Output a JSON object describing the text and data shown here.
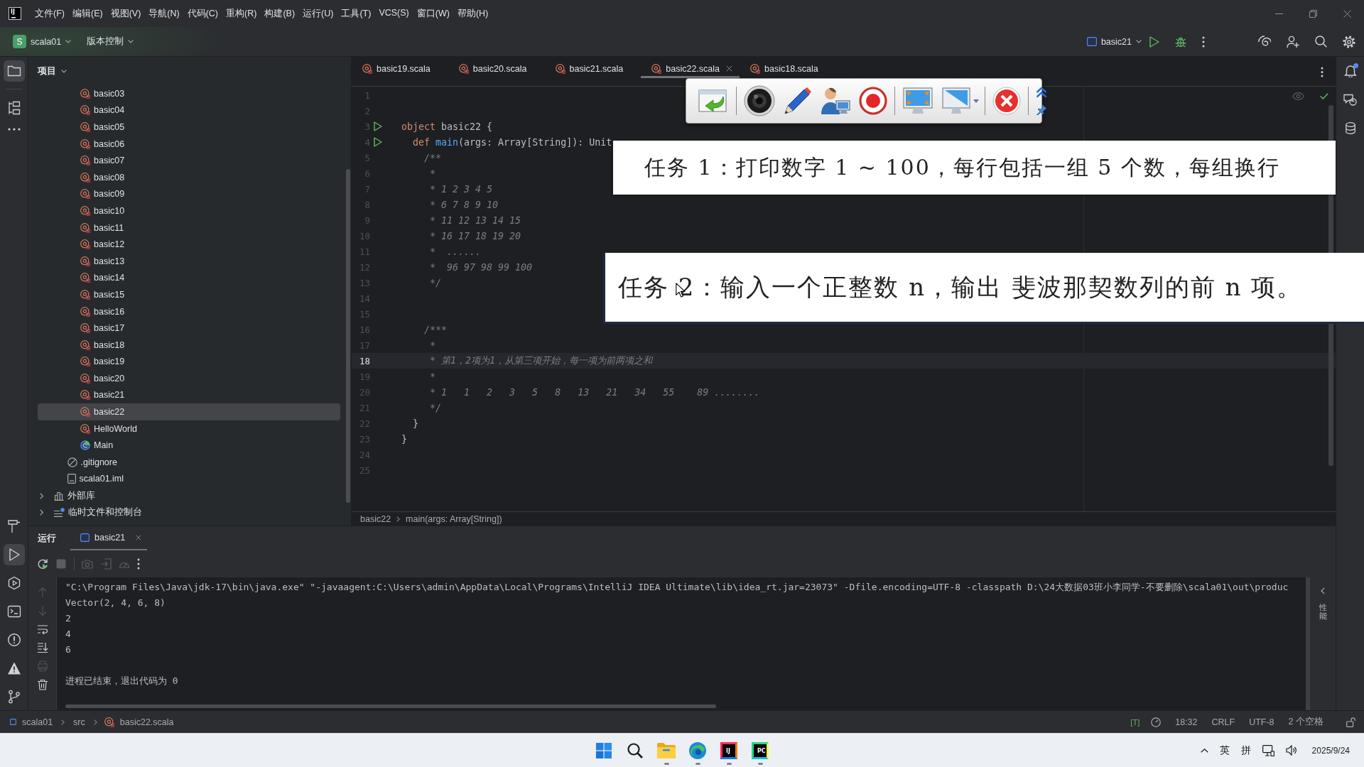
{
  "title_bar": {
    "logo": "IJ",
    "menu": [
      "文件(F)",
      "编辑(E)",
      "视图(V)",
      "导航(N)",
      "代码(C)",
      "重构(R)",
      "构建(B)",
      "运行(U)",
      "工具(T)",
      "VCS(S)",
      "窗口(W)",
      "帮助(H)"
    ]
  },
  "toolbar": {
    "project_badge": "S",
    "project": "scala01",
    "vcs": "版本控制",
    "run_config": "basic21"
  },
  "tool_strip": {
    "top": [
      {
        "selected": true
      },
      {
        "selected": false
      },
      {
        "selected": false
      }
    ],
    "bottom": [
      {
        "selected": false
      },
      {
        "selected": true
      },
      {
        "selected": false
      },
      {
        "selected": false
      },
      {
        "selected": false
      },
      {
        "selected": false
      },
      {
        "selected": false
      }
    ]
  },
  "right_strip": {
    "notifications_unread": true
  },
  "project_panel": {
    "title": "项目",
    "tree": [
      {
        "children": [
          {
            "children": [
              {
                "label": "basic03",
                "kind": "object",
                "selected": false
              },
              {
                "label": "basic04",
                "kind": "object",
                "selected": false
              },
              {
                "label": "basic05",
                "kind": "object",
                "selected": false
              },
              {
                "label": "basic06",
                "kind": "object",
                "selected": false
              },
              {
                "label": "basic07",
                "kind": "object",
                "selected": false
              },
              {
                "label": "basic08",
                "kind": "object",
                "selected": false
              },
              {
                "label": "basic09",
                "kind": "object",
                "selected": false
              },
              {
                "label": "basic10",
                "kind": "object",
                "selected": false
              },
              {
                "label": "basic11",
                "kind": "object",
                "selected": false
              },
              {
                "label": "basic12",
                "kind": "object",
                "selected": false
              },
              {
                "label": "basic13",
                "kind": "object",
                "selected": false
              },
              {
                "label": "basic14",
                "kind": "object",
                "selected": false
              },
              {
                "label": "basic15",
                "kind": "object",
                "selected": false
              },
              {
                "label": "basic16",
                "kind": "object",
                "selected": false
              },
              {
                "label": "basic17",
                "kind": "object",
                "selected": false
              },
              {
                "label": "basic18",
                "kind": "object",
                "selected": false
              },
              {
                "label": "basic19",
                "kind": "object",
                "selected": false
              },
              {
                "label": "basic20",
                "kind": "object",
                "selected": false
              },
              {
                "label": "basic21",
                "kind": "object",
                "selected": false
              },
              {
                "label": "basic22",
                "kind": "object",
                "selected": true
              },
              {
                "label": "HelloWorld",
                "kind": "object",
                "selected": false
              },
              {
                "label": "Main",
                "kind": "class",
                "selected": false
              }
            ]
          },
          {
            "label": ".gitignore",
            "kind": "ignored",
            "selected": false
          },
          {
            "label": "scala01.iml",
            "kind": "module",
            "selected": false
          }
        ]
      },
      {
        "label": "外部库",
        "kind": "library",
        "expanded": false,
        "selected": false
      },
      {
        "label": "临时文件和控制台",
        "kind": "scratches",
        "expanded": false,
        "selected": false
      }
    ]
  },
  "editor": {
    "tabs": [
      {
        "label": "basic19.scala",
        "selected": false
      },
      {
        "label": "basic20.scala",
        "selected": false
      },
      {
        "label": "basic21.scala",
        "selected": false
      },
      {
        "label": "basic22.scala",
        "selected": true
      },
      {
        "label": "basic18.scala",
        "selected": false
      }
    ],
    "lines": [
      {
        "number": "1",
        "current": false,
        "run": false
      },
      {
        "number": "2",
        "current": false,
        "run": false
      },
      {
        "number": "3",
        "current": false,
        "run": true,
        "tokens": [
          {
            "kind": "keyword",
            "text": "object"
          },
          {
            "kind": "plain",
            "text": " basic22 {"
          }
        ]
      },
      {
        "number": "4",
        "current": false,
        "run": true,
        "tokens": [
          {
            "kind": "keyword",
            "text": "  def "
          },
          {
            "kind": "function",
            "text": "main"
          },
          {
            "kind": "plain",
            "text": "(args: Array[String]): Unit"
          }
        ]
      },
      {
        "number": "5",
        "current": false,
        "run": false,
        "tokens": [
          {
            "kind": "comment",
            "text": "    /**"
          }
        ]
      },
      {
        "number": "6",
        "current": false,
        "run": false,
        "tokens": [
          {
            "kind": "comment",
            "text": "     *"
          }
        ]
      },
      {
        "number": "7",
        "current": false,
        "run": false,
        "tokens": [
          {
            "kind": "comment",
            "text": "     * 1 2 3 4 5"
          }
        ]
      },
      {
        "number": "8",
        "current": false,
        "run": false,
        "tokens": [
          {
            "kind": "comment",
            "text": "     * 6 7 8 9 10"
          }
        ]
      },
      {
        "number": "9",
        "current": false,
        "run": false,
        "tokens": [
          {
            "kind": "comment",
            "text": "     * 11 12 13 14 15"
          }
        ]
      },
      {
        "number": "10",
        "current": false,
        "run": false,
        "tokens": [
          {
            "kind": "comment",
            "text": "     * 16 17 18 19 20"
          }
        ]
      },
      {
        "number": "11",
        "current": false,
        "run": false,
        "tokens": [
          {
            "kind": "comment",
            "text": "     *  ......"
          }
        ]
      },
      {
        "number": "12",
        "current": false,
        "run": false,
        "tokens": [
          {
            "kind": "comment",
            "text": "     *  96 97 98 99 100"
          }
        ]
      },
      {
        "number": "13",
        "current": false,
        "run": false,
        "tokens": [
          {
            "kind": "comment",
            "text": "     */"
          }
        ]
      },
      {
        "number": "14",
        "current": false,
        "run": false
      },
      {
        "number": "15",
        "current": false,
        "run": false
      },
      {
        "number": "16",
        "current": false,
        "run": false,
        "tokens": [
          {
            "kind": "comment",
            "text": "    /***"
          }
        ]
      },
      {
        "number": "17",
        "current": false,
        "run": false,
        "tokens": [
          {
            "kind": "comment",
            "text": "     *"
          }
        ]
      },
      {
        "number": "18",
        "current": true,
        "run": false,
        "tokens": [
          {
            "kind": "comment",
            "text": "     * 第1，2项为1，从第三项开始，每一项为前两项之和"
          }
        ]
      },
      {
        "number": "19",
        "current": false,
        "run": false,
        "tokens": [
          {
            "kind": "comment",
            "text": "     *"
          }
        ]
      },
      {
        "number": "20",
        "current": false,
        "run": false,
        "tokens": [
          {
            "kind": "comment",
            "text": "     * 1   1   2   3   5   8   13   21   34   55    89 ........"
          }
        ]
      },
      {
        "number": "21",
        "current": false,
        "run": false,
        "tokens": [
          {
            "kind": "comment",
            "text": "     */"
          }
        ]
      },
      {
        "number": "22",
        "current": false,
        "run": false,
        "tokens": [
          {
            "kind": "plain",
            "text": "  }"
          }
        ]
      },
      {
        "number": "23",
        "current": false,
        "run": false,
        "tokens": [
          {
            "kind": "plain",
            "text": "}"
          }
        ]
      },
      {
        "number": "24",
        "current": false,
        "run": false
      },
      {
        "number": "25",
        "current": false,
        "run": false
      }
    ],
    "breadcrumb": [
      "basic22",
      "main(args: Array[String])"
    ]
  },
  "captions": [
    "任务 1：打印数字 1 ~ 100，每行包括一组 5 个数，每组换行",
    "任务 2：输入一个正整数 n，输出 斐波那契数列的前 n 项。"
  ],
  "run_panel": {
    "title": "运行",
    "tabs": [
      {
        "label": "basic21",
        "selected": true
      }
    ],
    "toolbar": [
      {
        "disabled": false
      },
      {
        "disabled": true
      },
      {
        "disabled": true
      },
      {
        "disabled": true
      },
      {
        "disabled": true
      },
      {
        "disabled": false
      }
    ],
    "side_tools": [
      {
        "disabled": true
      },
      {
        "disabled": true
      },
      {
        "disabled": false
      },
      {
        "disabled": false
      },
      {
        "disabled": true
      },
      {
        "disabled": false
      }
    ],
    "output": [
      "\"C:\\Program Files\\Java\\jdk-17\\bin\\java.exe\" \"-javaagent:C:\\Users\\admin\\AppData\\Local\\Programs\\IntelliJ IDEA Ultimate\\lib\\idea_rt.jar=23073\" -Dfile.encoding=UTF-8 -classpath D:\\24大数据03班小李同学-不要删除\\scala01\\out\\produc",
      "Vector(2, 4, 6, 8)",
      "2",
      "4",
      "6"
    ],
    "exit_message": "进程已结束，退出代码为 0",
    "side_label": "性能"
  },
  "status_bar": {
    "path": [
      "scala01",
      "src",
      "basic22.scala"
    ],
    "plugin": "[T]",
    "items": [
      "18:32",
      "CRLF",
      "UTF-8",
      "2 个空格"
    ]
  },
  "taskbar": {
    "apps": [
      {
        "kind": "start",
        "running": false
      },
      {
        "kind": "search",
        "running": false
      },
      {
        "kind": "explorer",
        "running": true
      },
      {
        "kind": "browser",
        "running": true
      },
      {
        "kind": "ide",
        "label": "IJ",
        "running": true
      },
      {
        "kind": "ide2",
        "label": "PC",
        "running": true
      }
    ],
    "tray": {
      "input_mode": "英",
      "ime": "拼",
      "date": "2025/9/24"
    }
  }
}
